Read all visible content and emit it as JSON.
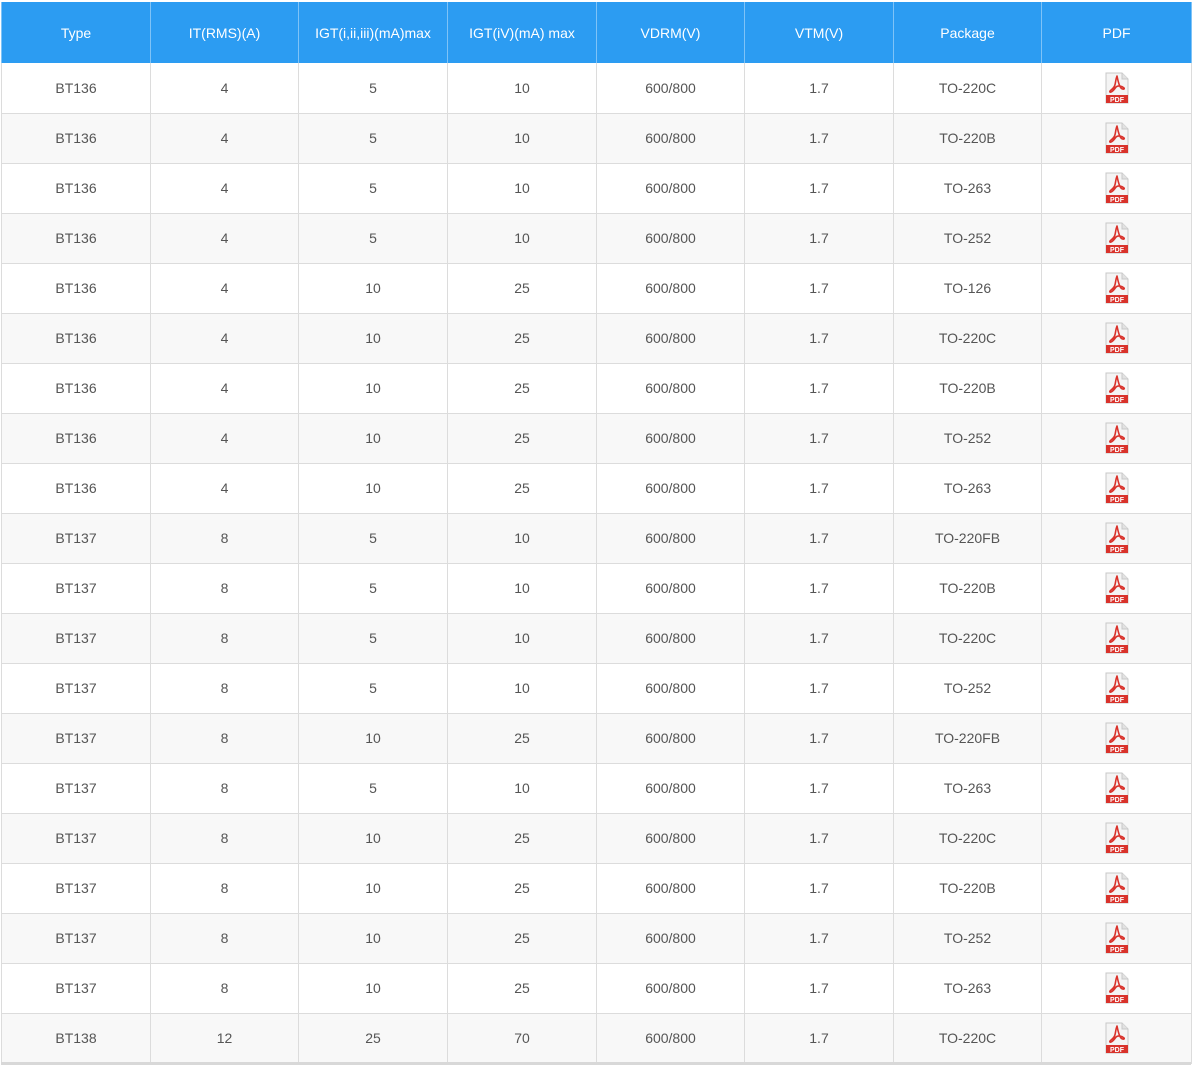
{
  "table": {
    "headers": [
      "Type",
      "IT(RMS)(A)",
      "IGT(i,ii,iii)(mA)max",
      "IGT(iV)(mA) max",
      "VDRM(V)",
      "VTM(V)",
      "Package",
      "PDF"
    ],
    "pdf_icon": "pdf-file-icon",
    "pdf_label": "PDF",
    "colors": {
      "header_bg": "#2c9cf2",
      "pdf_red": "#d9322b"
    },
    "rows": [
      [
        "BT136",
        "4",
        "5",
        "10",
        "600/800",
        "1.7",
        "TO-220C"
      ],
      [
        "BT136",
        "4",
        "5",
        "10",
        "600/800",
        "1.7",
        "TO-220B"
      ],
      [
        "BT136",
        "4",
        "5",
        "10",
        "600/800",
        "1.7",
        "TO-263"
      ],
      [
        "BT136",
        "4",
        "5",
        "10",
        "600/800",
        "1.7",
        "TO-252"
      ],
      [
        "BT136",
        "4",
        "10",
        "25",
        "600/800",
        "1.7",
        "TO-126"
      ],
      [
        "BT136",
        "4",
        "10",
        "25",
        "600/800",
        "1.7",
        "TO-220C"
      ],
      [
        "BT136",
        "4",
        "10",
        "25",
        "600/800",
        "1.7",
        "TO-220B"
      ],
      [
        "BT136",
        "4",
        "10",
        "25",
        "600/800",
        "1.7",
        "TO-252"
      ],
      [
        "BT136",
        "4",
        "10",
        "25",
        "600/800",
        "1.7",
        "TO-263"
      ],
      [
        "BT137",
        "8",
        "5",
        "10",
        "600/800",
        "1.7",
        "TO-220FB"
      ],
      [
        "BT137",
        "8",
        "5",
        "10",
        "600/800",
        "1.7",
        "TO-220B"
      ],
      [
        "BT137",
        "8",
        "5",
        "10",
        "600/800",
        "1.7",
        "TO-220C"
      ],
      [
        "BT137",
        "8",
        "5",
        "10",
        "600/800",
        "1.7",
        "TO-252"
      ],
      [
        "BT137",
        "8",
        "10",
        "25",
        "600/800",
        "1.7",
        "TO-220FB"
      ],
      [
        "BT137",
        "8",
        "5",
        "10",
        "600/800",
        "1.7",
        "TO-263"
      ],
      [
        "BT137",
        "8",
        "10",
        "25",
        "600/800",
        "1.7",
        "TO-220C"
      ],
      [
        "BT137",
        "8",
        "10",
        "25",
        "600/800",
        "1.7",
        "TO-220B"
      ],
      [
        "BT137",
        "8",
        "10",
        "25",
        "600/800",
        "1.7",
        "TO-252"
      ],
      [
        "BT137",
        "8",
        "10",
        "25",
        "600/800",
        "1.7",
        "TO-263"
      ],
      [
        "BT138",
        "12",
        "25",
        "70",
        "600/800",
        "1.7",
        "TO-220C"
      ]
    ]
  }
}
